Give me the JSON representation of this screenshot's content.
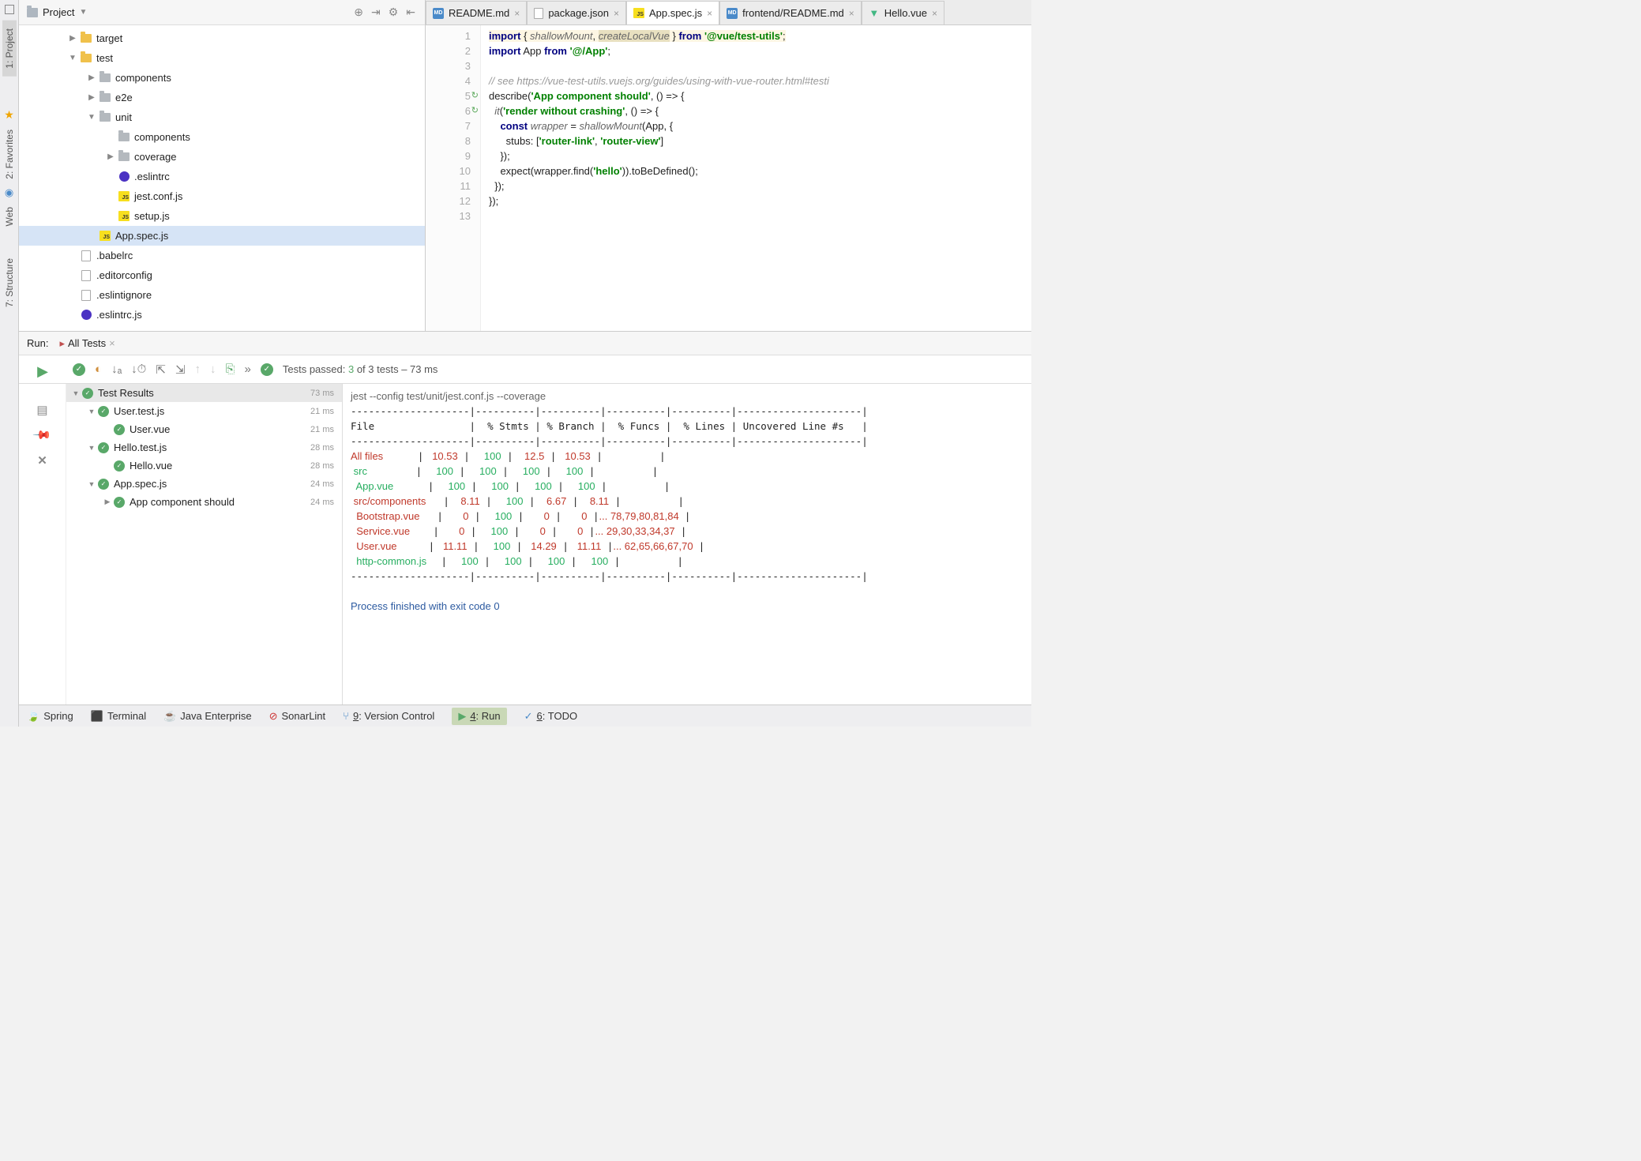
{
  "project": {
    "title": "Project",
    "tree": [
      {
        "indent": 60,
        "chev": "▶",
        "icon": "folder-yellow",
        "label": "target"
      },
      {
        "indent": 60,
        "chev": "▼",
        "icon": "folder-yellow",
        "label": "test"
      },
      {
        "indent": 84,
        "chev": "▶",
        "icon": "folder-grey",
        "label": "components"
      },
      {
        "indent": 84,
        "chev": "▶",
        "icon": "folder-grey",
        "label": "e2e"
      },
      {
        "indent": 84,
        "chev": "▼",
        "icon": "folder-grey",
        "label": "unit"
      },
      {
        "indent": 108,
        "chev": "",
        "icon": "folder-grey",
        "label": "components"
      },
      {
        "indent": 108,
        "chev": "▶",
        "icon": "folder-grey",
        "label": "coverage"
      },
      {
        "indent": 108,
        "chev": "",
        "icon": "eslint",
        "label": ".eslintrc"
      },
      {
        "indent": 108,
        "chev": "",
        "icon": "js",
        "label": "jest.conf.js"
      },
      {
        "indent": 108,
        "chev": "",
        "icon": "js",
        "label": "setup.js"
      },
      {
        "indent": 84,
        "chev": "",
        "icon": "js",
        "label": "App.spec.js",
        "sel": true
      },
      {
        "indent": 60,
        "chev": "",
        "icon": "file",
        "label": ".babelrc"
      },
      {
        "indent": 60,
        "chev": "",
        "icon": "file",
        "label": ".editorconfig"
      },
      {
        "indent": 60,
        "chev": "",
        "icon": "file",
        "label": ".eslintignore"
      },
      {
        "indent": 60,
        "chev": "",
        "icon": "eslint",
        "label": ".eslintrc.js"
      }
    ]
  },
  "tabs": [
    {
      "icon": "md",
      "label": "README.md"
    },
    {
      "icon": "file",
      "label": "package.json"
    },
    {
      "icon": "js",
      "label": "App.spec.js",
      "active": true
    },
    {
      "icon": "md",
      "label": "frontend/README.md"
    },
    {
      "icon": "vue",
      "label": "Hello.vue"
    }
  ],
  "code_lines": 13,
  "run": {
    "label": "Run:",
    "tab": "All Tests",
    "status_prefix": "Tests passed: ",
    "status_count": "3",
    "status_suffix": " of 3 tests – 73 ms"
  },
  "test_tree": [
    {
      "indent": 4,
      "chev": "▼",
      "label": "Test Results",
      "time": "73 ms",
      "header": true
    },
    {
      "indent": 24,
      "chev": "▼",
      "label": "User.test.js",
      "time": "21 ms"
    },
    {
      "indent": 44,
      "chev": "",
      "label": "User.vue",
      "time": "21 ms"
    },
    {
      "indent": 24,
      "chev": "▼",
      "label": "Hello.test.js",
      "time": "28 ms"
    },
    {
      "indent": 44,
      "chev": "",
      "label": "Hello.vue",
      "time": "28 ms"
    },
    {
      "indent": 24,
      "chev": "▼",
      "label": "App.spec.js",
      "time": "24 ms"
    },
    {
      "indent": 44,
      "chev": "▶",
      "label": "App component should",
      "time": "24 ms"
    }
  ],
  "console": {
    "cmd": "jest --config test/unit/jest.conf.js --coverage",
    "header": "File                |  % Stmts | % Branch |  % Funcs |  % Lines | Uncovered Line #s   |",
    "divider": "--------------------|----------|----------|----------|----------|---------------------|",
    "rows": [
      {
        "file": "All files          ",
        "stmts": "   10.53",
        "branch": "     100",
        "funcs": "    12.5",
        "lines": "   10.53",
        "unc": "                    ",
        "cls": "r"
      },
      {
        "file": " src               ",
        "stmts": "     100",
        "branch": "     100",
        "funcs": "     100",
        "lines": "     100",
        "unc": "                    ",
        "cls": "g"
      },
      {
        "file": "  App.vue          ",
        "stmts": "     100",
        "branch": "     100",
        "funcs": "     100",
        "lines": "     100",
        "unc": "                    ",
        "cls": "g"
      },
      {
        "file": " src/components    ",
        "stmts": "    8.11",
        "branch": "     100",
        "funcs": "    6.67",
        "lines": "    8.11",
        "unc": "                    ",
        "cls": "r"
      },
      {
        "file": "  Bootstrap.vue    ",
        "stmts": "       0",
        "branch": "     100",
        "funcs": "       0",
        "lines": "       0",
        "unc": "... 78,79,80,81,84  ",
        "cls": "r"
      },
      {
        "file": "  Service.vue      ",
        "stmts": "       0",
        "branch": "     100",
        "funcs": "       0",
        "lines": "       0",
        "unc": "... 29,30,33,34,37  ",
        "cls": "r"
      },
      {
        "file": "  User.vue         ",
        "stmts": "   11.11",
        "branch": "     100",
        "funcs": "   14.29",
        "lines": "   11.11",
        "unc": "... 62,65,66,67,70  ",
        "cls": "r"
      },
      {
        "file": "  http-common.js   ",
        "stmts": "     100",
        "branch": "     100",
        "funcs": "     100",
        "lines": "     100",
        "unc": "                    ",
        "cls": "g"
      }
    ],
    "exit": "Process finished with exit code 0"
  },
  "statusbar": [
    {
      "icon": "leaf",
      "label": "Spring"
    },
    {
      "icon": "term",
      "label": "Terminal"
    },
    {
      "icon": "java",
      "label": "Java Enterprise"
    },
    {
      "icon": "sonar",
      "label": "SonarLint"
    },
    {
      "icon": "vcs",
      "label": "9: Version Control",
      "ul": "9"
    },
    {
      "icon": "play",
      "label": "4: Run",
      "active": true,
      "ul": "4"
    },
    {
      "icon": "todo",
      "label": "6: TODO",
      "ul": "6"
    }
  ],
  "left_tabs": [
    "1: Project",
    "2: Favorites",
    "Web",
    "7: Structure"
  ]
}
